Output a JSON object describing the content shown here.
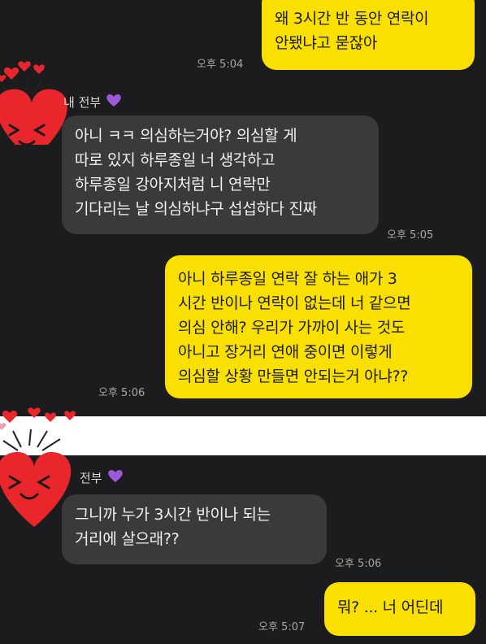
{
  "chat": {
    "messages": [
      {
        "text": "왜 3시간 반 동안 연락이\n안됐냐고 묻잖아",
        "time": "오후 5:04"
      },
      {
        "sender": "내 전부",
        "text": "아니 ㅋㅋ 의심하는거야? 의심할 게\n따로 있지 하루종일 너 생각하고\n하루종일 강아지처럼 니 연락만\n기다리는 날 의심하냐구 섭섭하다 진짜",
        "time": "오후 5:05"
      },
      {
        "text": "아니 하루종일 연락 잘 하는 애가 3\n시간 반이나 연락이 없는데 너 같으면\n의심 안해? 우리가 가까이 사는 것도\n아니고 장거리 연애 중이면 이렇게\n의심할 상황 만들면 안되는거 아냐??",
        "time": "오후 5:06"
      },
      {
        "sender": "전부",
        "text": "그니까 누가 3시간 반이나 되는\n거리에 살으래??",
        "time": "오후 5:06"
      },
      {
        "text": "뭐? ... 너 어딘데",
        "time": "오후 5:07"
      }
    ]
  },
  "icons": {
    "purple_heart": "purple-heart-icon",
    "sticker": "shy-heart-sticker"
  },
  "colors": {
    "background": "#1c1c1e",
    "my_bubble": "#f9e000",
    "their_bubble": "#3a3a3c",
    "purple_heart": "#9b59d6",
    "sticker_heart": "#e8262c"
  }
}
